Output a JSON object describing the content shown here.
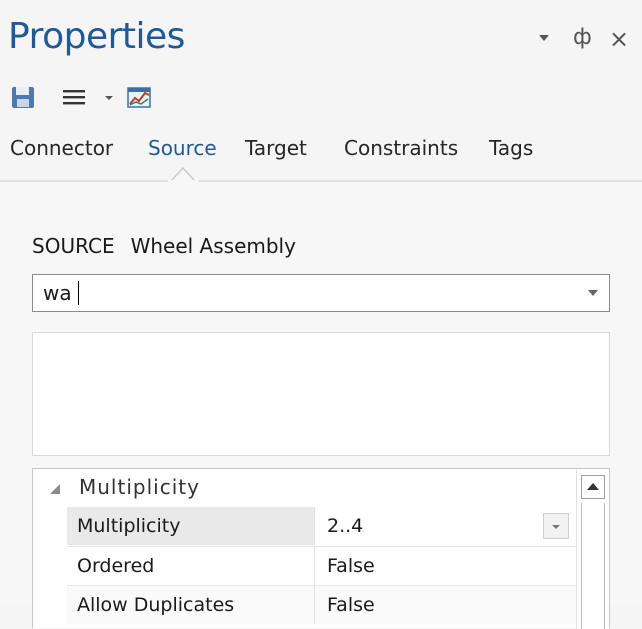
{
  "window": {
    "title": "Properties",
    "dropdown_icon": "chevron-down-icon",
    "pin_glyph": "ф",
    "close_glyph": "×"
  },
  "toolbar": {
    "icons": [
      "save-icon",
      "menu-icon",
      "chevron-down-icon",
      "chart-icon"
    ]
  },
  "tabs": [
    {
      "label": "Connector",
      "active": false
    },
    {
      "label": "Source",
      "active": true
    },
    {
      "label": "Target",
      "active": false
    },
    {
      "label": "Constraints",
      "active": false
    },
    {
      "label": "Tags",
      "active": false
    }
  ],
  "source": {
    "label": "SOURCE",
    "name": "Wheel Assembly",
    "combo_value": "wa"
  },
  "properties": {
    "group": "Multiplicity",
    "rows": [
      {
        "name": "Multiplicity",
        "value": "2..4"
      },
      {
        "name": "Ordered",
        "value": "False"
      },
      {
        "name": "Allow Duplicates",
        "value": "False"
      }
    ]
  },
  "colors": {
    "title": "#1f5a96",
    "active_tab": "#1f5a96",
    "background": "#f5f5f5"
  }
}
